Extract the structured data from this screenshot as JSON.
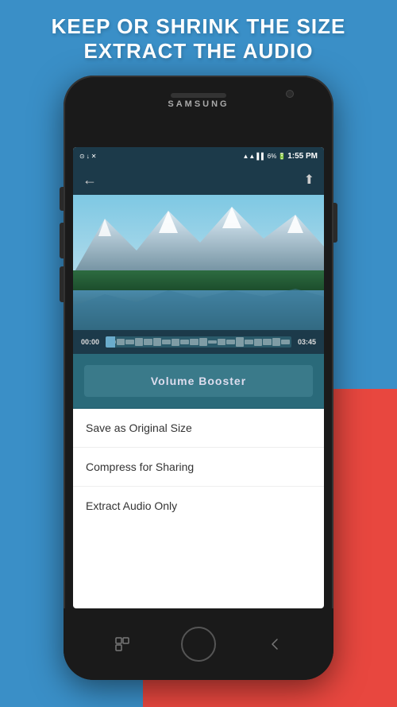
{
  "background": {
    "blue_color": "#3a8fc7",
    "red_color": "#e8473f"
  },
  "headline": {
    "line1": "KEEP OR SHRINK THE SIZE",
    "line2": "EXTRACT THE AUDIO"
  },
  "phone": {
    "brand": "SAMSUNG",
    "status_bar": {
      "battery": "6%",
      "time": "1:55 PM",
      "signal_icon": "📶"
    },
    "app": {
      "header_bg": "#1c3a4a",
      "back_button_label": "←",
      "share_button_label": "⬆"
    },
    "video": {
      "time_start": "00:00",
      "time_end": "03:45"
    },
    "volume_booster": {
      "label": "Volume Booster"
    },
    "menu_items": [
      {
        "label": "Save as Original Size"
      },
      {
        "label": "Compress for Sharing"
      },
      {
        "label": "Extract Audio Only"
      }
    ],
    "nav": {
      "back_icon": "◻",
      "home_circle": "",
      "recent_icon": "◁"
    }
  }
}
